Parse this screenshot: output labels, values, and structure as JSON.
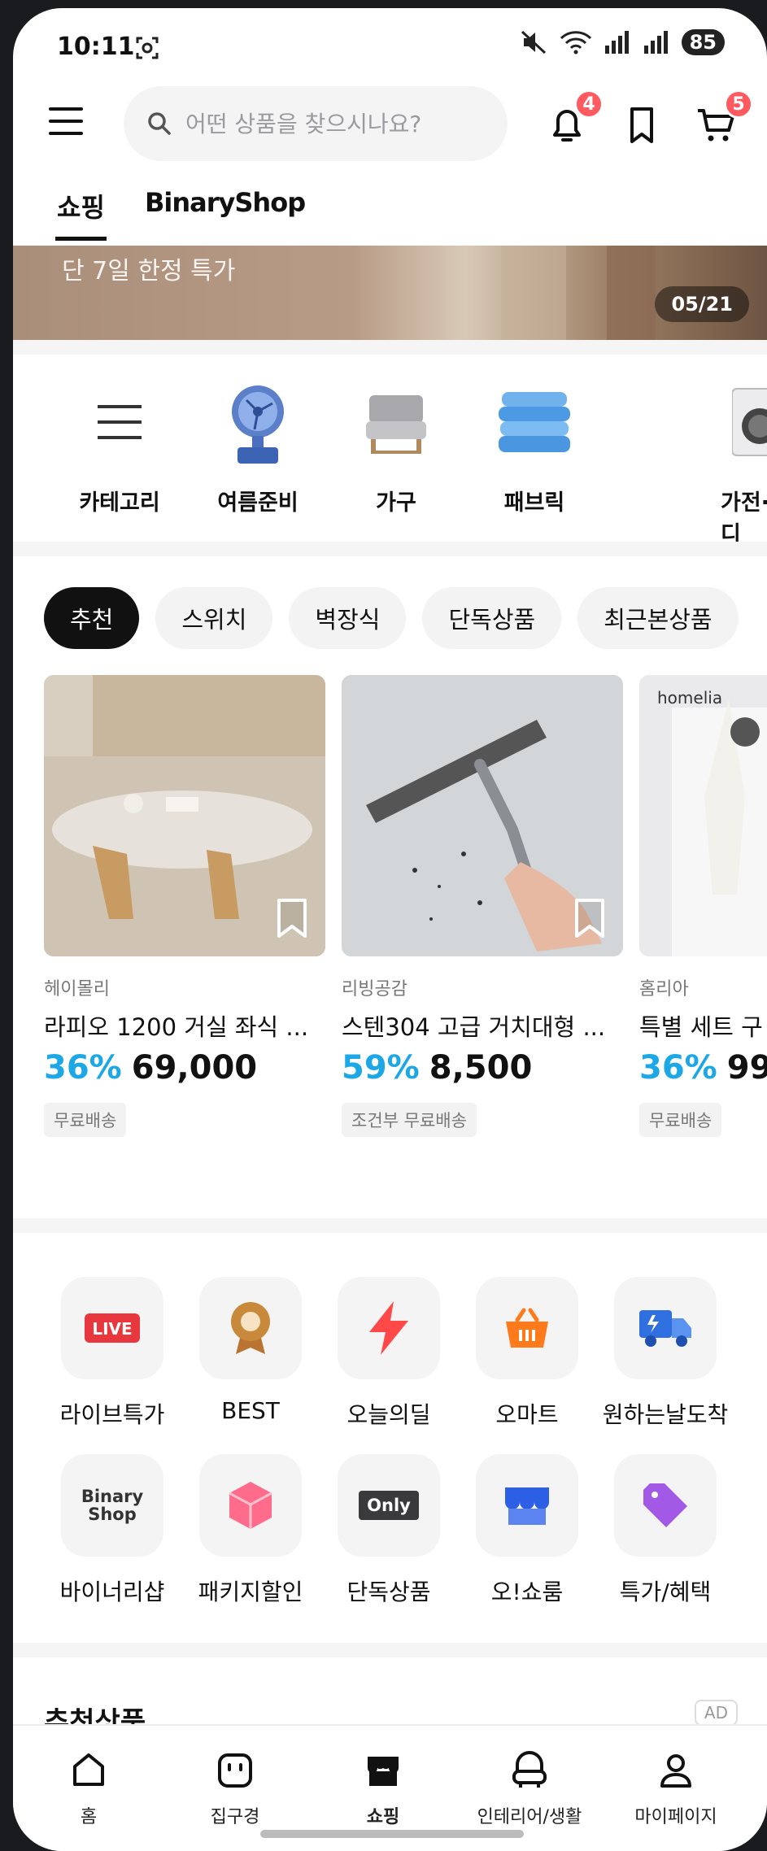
{
  "status_bar": {
    "time": "10:11",
    "battery": "85"
  },
  "header": {
    "search_placeholder": "어떤 상품을 찾으시나요?",
    "notification_count": "4",
    "cart_count": "5"
  },
  "top_tabs": [
    {
      "label": "쇼핑"
    },
    {
      "label": "BinaryShop"
    }
  ],
  "banner": {
    "text": "단 7일 한정 특가",
    "counter": "05/21"
  },
  "categories": [
    {
      "label": "카테고리",
      "icon": "menu-icon"
    },
    {
      "label": "여름준비",
      "icon": "fan-icon"
    },
    {
      "label": "가구",
      "icon": "chair-icon"
    },
    {
      "label": "패브릭",
      "icon": "blanket-icon"
    },
    {
      "label": "가전·디",
      "icon": "washer-icon"
    }
  ],
  "chips": [
    {
      "label": "추천",
      "active": true
    },
    {
      "label": "스위치"
    },
    {
      "label": "벽장식"
    },
    {
      "label": "단독상품"
    },
    {
      "label": "최근본상품"
    }
  ],
  "products": [
    {
      "brand": "헤이몰리",
      "title": "라피오 1200 거실 좌식 ...",
      "discount": "36%",
      "price": "69,000",
      "tag": "무료배송"
    },
    {
      "brand": "리빙공감",
      "title": "스텐304 고급 거치대형 ...",
      "discount": "59%",
      "price": "8,500",
      "tag": "조건부 무료배송"
    },
    {
      "brand": "홈리아",
      "title": "특별 세트 구",
      "discount": "36%",
      "price": "99,",
      "tag": "무료배송",
      "image_text": "homelia"
    }
  ],
  "shortcuts": [
    {
      "label": "라이브특가",
      "icon": "live-icon",
      "icon_text": "LIVE"
    },
    {
      "label": "BEST",
      "icon": "medal-icon"
    },
    {
      "label": "오늘의딜",
      "icon": "lightning-icon"
    },
    {
      "label": "오마트",
      "icon": "basket-icon"
    },
    {
      "label": "원하는날도착",
      "icon": "delivery-truck-icon"
    },
    {
      "label": "바이너리샵",
      "icon": "binary-shop-logo-icon",
      "icon_text": "Binary Shop"
    },
    {
      "label": "패키지할인",
      "icon": "package-discount-icon"
    },
    {
      "label": "단독상품",
      "icon": "only-icon",
      "icon_text": "Only"
    },
    {
      "label": "오!쇼룸",
      "icon": "showroom-icon"
    },
    {
      "label": "특가/혜택",
      "icon": "price-tag-icon"
    }
  ],
  "recommended": {
    "title": "추천상품",
    "ad_label": "AD"
  },
  "bottom_nav": [
    {
      "label": "홈",
      "icon": "home-icon"
    },
    {
      "label": "집구경",
      "icon": "house-tour-icon"
    },
    {
      "label": "쇼핑",
      "icon": "shopping-icon",
      "active": true
    },
    {
      "label": "인테리어/생활",
      "icon": "interior-icon"
    },
    {
      "label": "마이페이지",
      "icon": "profile-icon"
    }
  ],
  "colors": {
    "accent_blue": "#1ca7e6",
    "badge_red": "#ff5a5f",
    "live_red": "#e8383d",
    "best_gold": "#c9893a",
    "deal_red": "#ff4848",
    "mart_orange": "#ff7a1a",
    "truck_blue": "#2f6fe0",
    "package_pink": "#ff6b8a",
    "showroom_blue": "#2d5fe6",
    "tag_purple": "#a259e6"
  }
}
